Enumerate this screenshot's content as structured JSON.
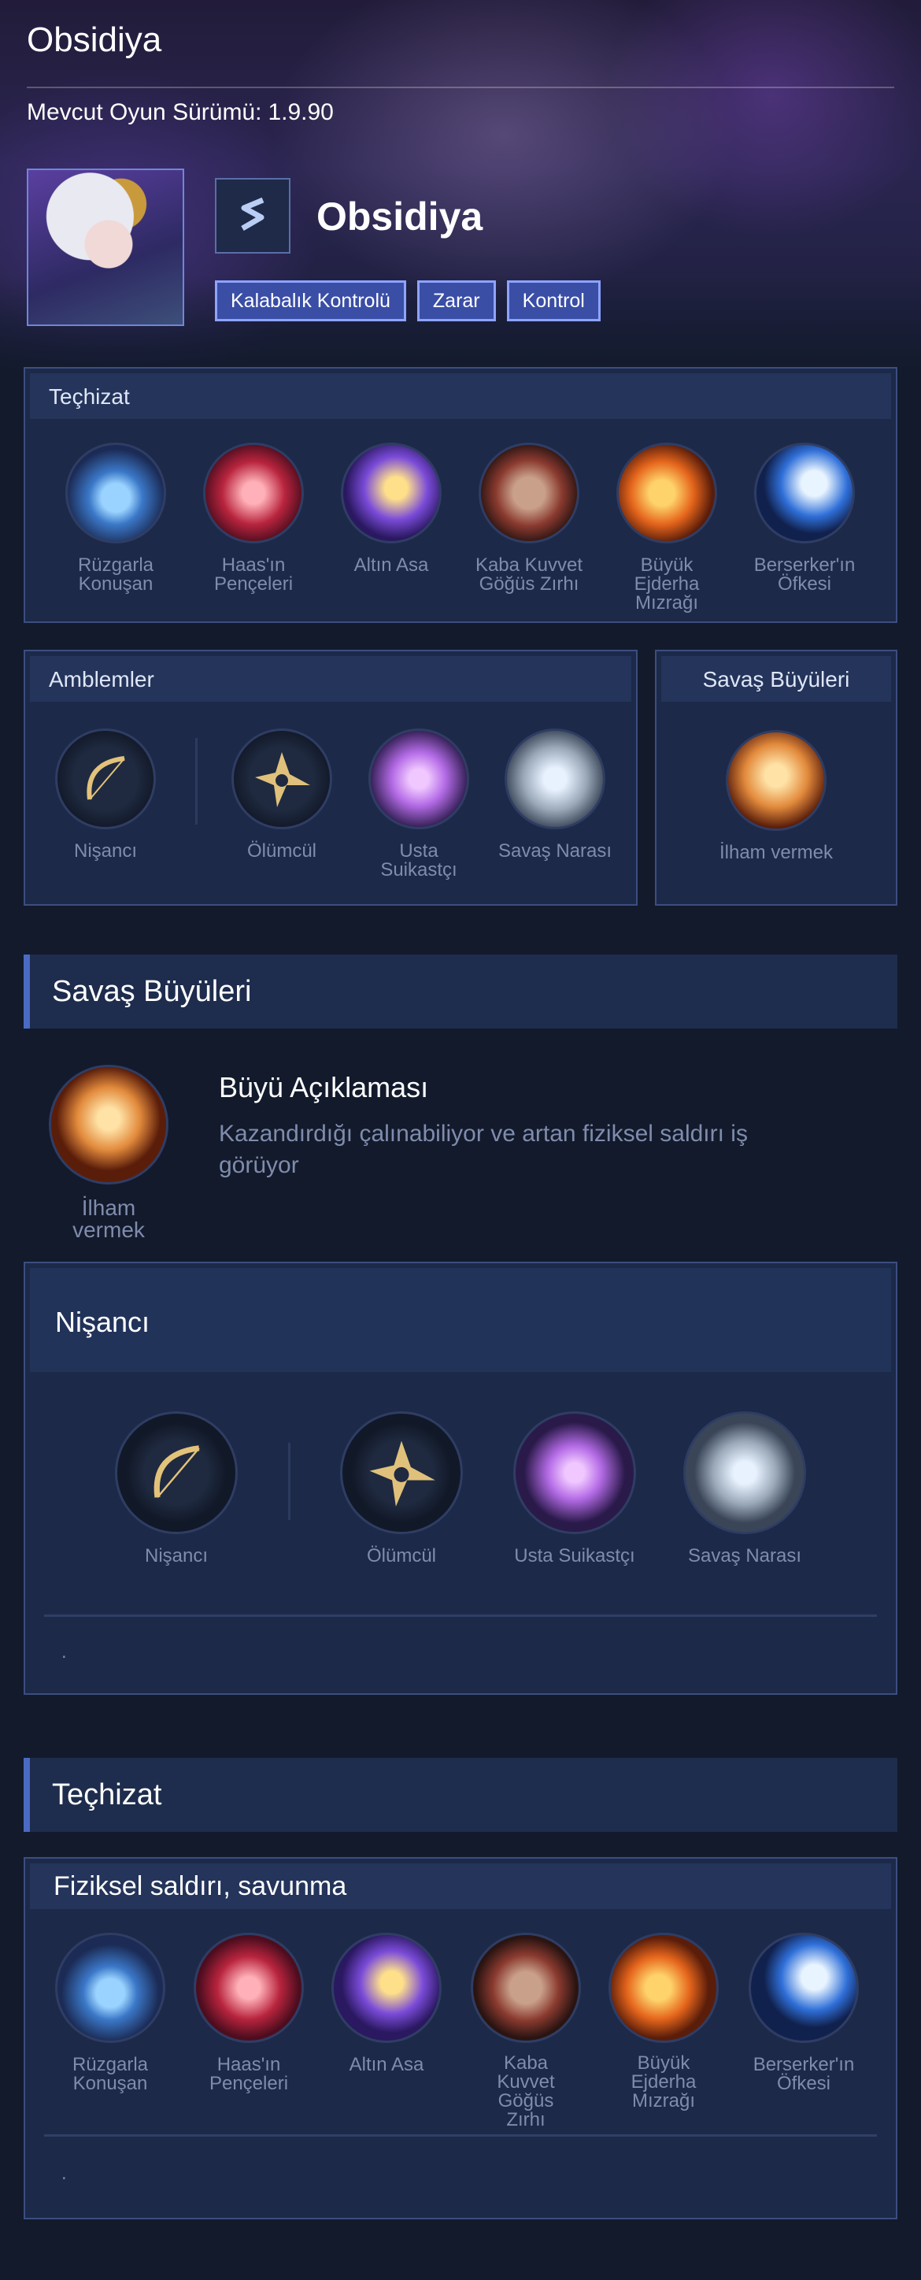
{
  "header": {
    "title": "Obsidiya",
    "version_label": "Mevcut Oyun Sürümü:",
    "version": "1.9.90"
  },
  "hero": {
    "name": "Obsidiya",
    "role_icon": "marksman-role-icon",
    "tags": [
      "Kalabalık Kontrolü",
      "Zarar",
      "Kontrol"
    ]
  },
  "summary": {
    "equipment_title": "Teçhizat",
    "equipment": [
      {
        "label": "Rüzgarla Konuşan",
        "icon": "windtalker-icon"
      },
      {
        "label": "Haas'ın Pençeleri",
        "icon": "haas-claws-icon"
      },
      {
        "label": "Altın Asa",
        "icon": "golden-staff-icon"
      },
      {
        "label": "Kaba Kuvvet Göğüs Zırhı",
        "icon": "brute-force-breastplate-icon"
      },
      {
        "label": "Büyük Ejderha Mızrağı",
        "icon": "great-dragon-spear-icon"
      },
      {
        "label": "Berserker'ın Öfkesi",
        "icon": "berserkers-fury-icon"
      }
    ],
    "emblems_title": "Amblemler",
    "emblems": [
      {
        "label": "Nişancı",
        "icon": "bow-icon"
      },
      {
        "label": "Ölümcül",
        "icon": "lethal-shuriken-icon"
      },
      {
        "label": "Usta Suikastçı",
        "icon": "crosshair-icon"
      },
      {
        "label": "Savaş Narası",
        "icon": "war-cry-icon"
      }
    ],
    "spells_title": "Savaş Büyüleri",
    "spell": {
      "label": "İlham vermek",
      "icon": "inspire-icon"
    }
  },
  "spell_section": {
    "title": "Savaş Büyüleri",
    "spell_label": "İlham vermek",
    "desc_title": "Büyü Açıklaması",
    "desc_text": "Kazandırdığı çalınabiliyor ve artan fiziksel saldırı iş görüyor"
  },
  "emblem_section": {
    "title": "Nişancı",
    "emblems": [
      {
        "label": "Nişancı",
        "icon": "bow-icon"
      },
      {
        "label": "Ölümcül",
        "icon": "lethal-shuriken-icon"
      },
      {
        "label": "Usta Suikastçı",
        "icon": "crosshair-icon"
      },
      {
        "label": "Savaş Narası",
        "icon": "war-cry-icon"
      }
    ],
    "note": "."
  },
  "equipment_section": {
    "title": "Teçhizat",
    "build_title": "Fiziksel saldırı, savunma",
    "items": [
      {
        "label": "Rüzgarla Konuşan",
        "icon": "windtalker-icon"
      },
      {
        "label": "Haas'ın Pençeleri",
        "icon": "haas-claws-icon"
      },
      {
        "label": "Altın Asa",
        "icon": "golden-staff-icon"
      },
      {
        "label": "Kaba Kuvvet Göğüs Zırhı",
        "icon": "brute-force-breastplate-icon"
      },
      {
        "label": "Büyük Ejderha Mızrağı",
        "icon": "great-dragon-spear-icon"
      },
      {
        "label": "Berserker'ın Öfkesi",
        "icon": "berserkers-fury-icon"
      }
    ],
    "note": "."
  },
  "colors": {
    "background": "#121a2c",
    "panel": "#1c2948",
    "panel_border": "#3b4e80",
    "tag_fill": "#3a4ea6",
    "tag_border": "#8ea3ff",
    "accent_bar": "#4a6bc4",
    "muted_text": "#7f8cac"
  }
}
